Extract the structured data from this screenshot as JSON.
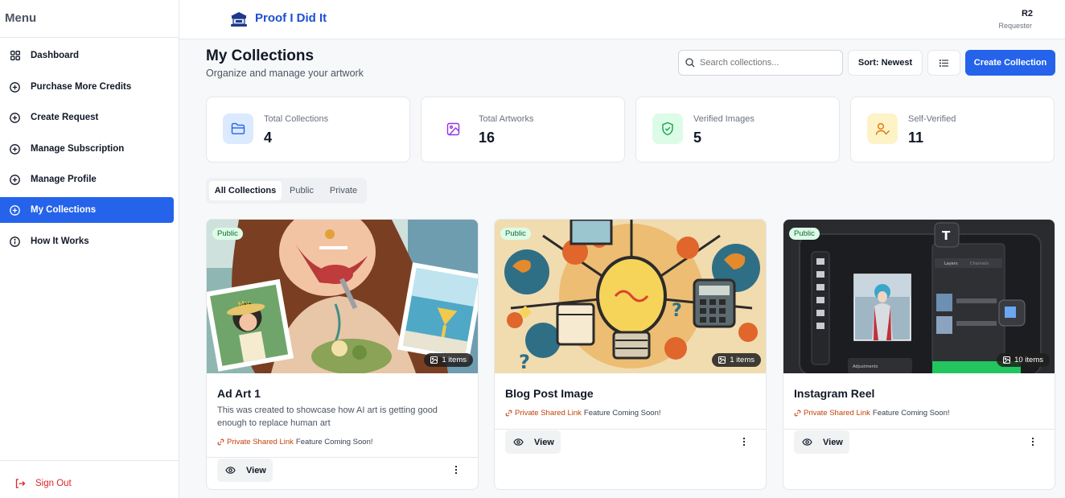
{
  "sidebar": {
    "title": "Menu",
    "items": [
      {
        "label": "Dashboard",
        "icon": "grid-icon"
      },
      {
        "label": "Purchase More Credits",
        "icon": "plus-circle-icon"
      },
      {
        "label": "Create Request",
        "icon": "plus-circle-icon"
      },
      {
        "label": "Manage Subscription",
        "icon": "plus-circle-icon"
      },
      {
        "label": "Manage Profile",
        "icon": "plus-circle-icon"
      },
      {
        "label": "My Collections",
        "icon": "plus-circle-icon",
        "active": true
      },
      {
        "label": "How It Works",
        "icon": "info-icon"
      }
    ],
    "sign_out": "Sign Out"
  },
  "header": {
    "brand": "Proof I Did It",
    "user_name": "R2",
    "user_role": "Requester"
  },
  "page": {
    "title": "My Collections",
    "subtitle": "Organize and manage your artwork",
    "search_placeholder": "Search collections...",
    "sort_label": "Sort: Newest",
    "create_label": "Create Collection"
  },
  "stats": [
    {
      "label": "Total Collections",
      "value": "4",
      "icon": "folder-icon",
      "color": "#dbeafe"
    },
    {
      "label": "Total Artworks",
      "value": "16",
      "icon": "image-icon",
      "color": "#f3e8ff"
    },
    {
      "label": "Verified Images",
      "value": "5",
      "icon": "shield-check-icon",
      "color": "#dcfce7"
    },
    {
      "label": "Self-Verified",
      "value": "11",
      "icon": "user-check-icon",
      "color": "#fef3c7"
    }
  ],
  "tabs": [
    "All Collections",
    "Public",
    "Private"
  ],
  "colors": {
    "accent": "#2563eb",
    "brand": "#1d4ed8",
    "danger": "#dc2626",
    "link": "#c2410c"
  },
  "collections": [
    {
      "title": "Ad Art 1",
      "description": "This was created to showcase how AI art is getting good enough to replace human art",
      "visibility": "Public",
      "items": "1 items",
      "share_link": "Private Shared Link",
      "share_note": "Feature Coming Soon!",
      "view_label": "View"
    },
    {
      "title": "Blog Post Image",
      "description": "",
      "visibility": "Public",
      "items": "1 items",
      "share_link": "Private Shared Link",
      "share_note": "Feature Coming Soon!",
      "view_label": "View"
    },
    {
      "title": "Instagram Reel",
      "description": "",
      "visibility": "Public",
      "items": "10 items",
      "share_link": "Private Shared Link",
      "share_note": "Feature Coming Soon!",
      "view_label": "View"
    }
  ]
}
